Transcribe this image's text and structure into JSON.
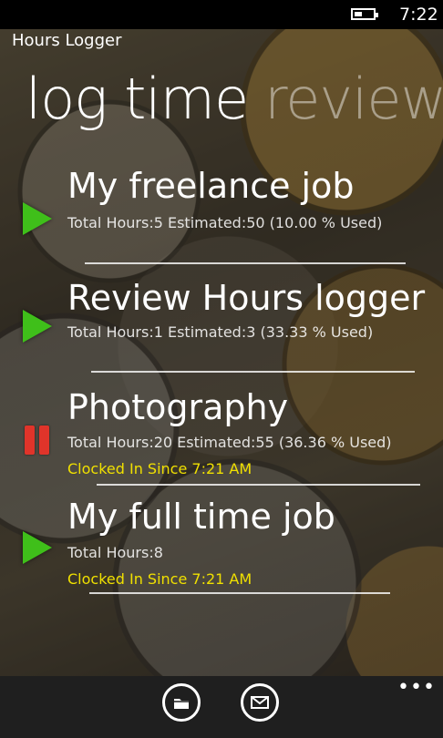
{
  "status_bar": {
    "time": "7:22"
  },
  "app": {
    "title": "Hours Logger"
  },
  "pivot": {
    "active": "log time",
    "inactive": "review"
  },
  "jobs": [
    {
      "name": "My freelance job",
      "stats": "Total Hours:5 Estimated:50 (10.00 % Used)",
      "clocked_in": "",
      "state": "play"
    },
    {
      "name": "Review Hours logger",
      "stats": "Total Hours:1 Estimated:3 (33.33 % Used)",
      "clocked_in": "",
      "state": "play"
    },
    {
      "name": "Photography",
      "stats": "Total Hours:20 Estimated:55 (36.36 % Used)",
      "clocked_in": "Clocked In Since 7:21 AM",
      "state": "pause"
    },
    {
      "name": "My full time job",
      "stats": "Total Hours:8",
      "clocked_in": "Clocked In Since 7:21 AM",
      "state": "play"
    }
  ],
  "app_bar": {
    "buttons": [
      "folder-icon",
      "mail-icon"
    ],
    "more": "•••"
  },
  "colors": {
    "play": "#3fbf1a",
    "pause": "#e0342a",
    "clocked_in": "#f0e000",
    "app_bar": "#1f1f1f"
  }
}
